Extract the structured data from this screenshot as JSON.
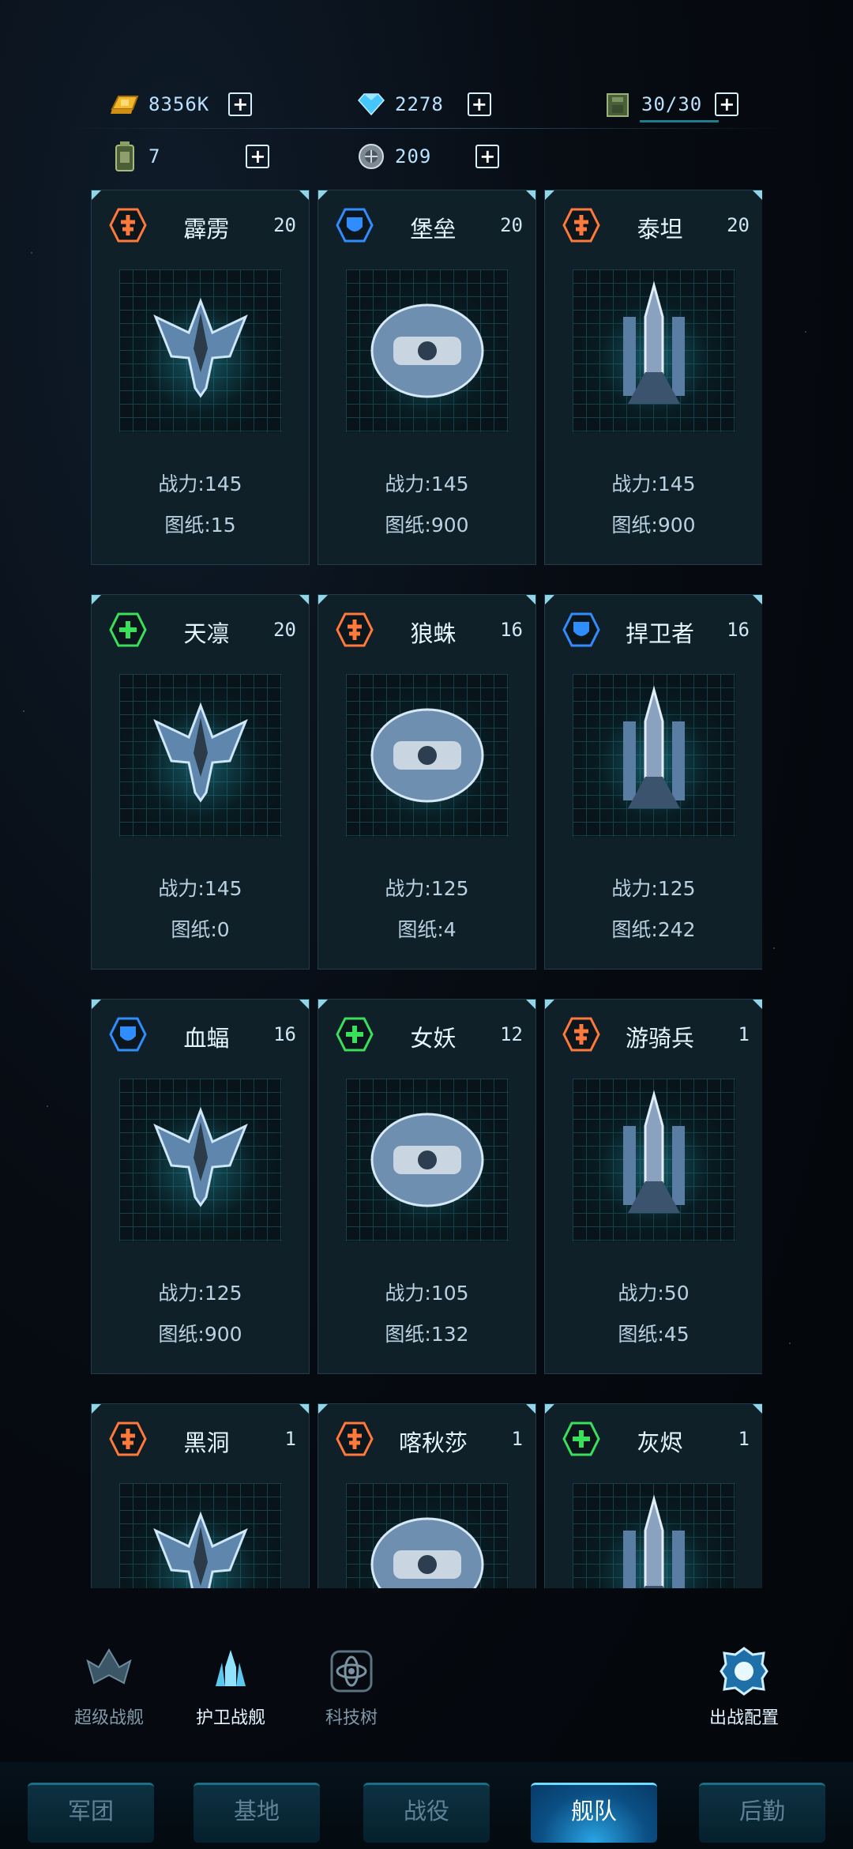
{
  "resources": {
    "gold": {
      "icon": "gold-bars-icon",
      "value": "8356K"
    },
    "diamond": {
      "icon": "diamond-icon",
      "value": "2278"
    },
    "capacity": {
      "icon": "cargo-crate-icon",
      "value": "30/30"
    },
    "fuel": {
      "icon": "fuel-canister-icon",
      "value": "7"
    },
    "alloy": {
      "icon": "alloy-disc-icon",
      "value": "209"
    }
  },
  "ships": [
    {
      "name": "霹雳",
      "level": "20",
      "type": "attack",
      "power": "战力:145",
      "blueprint": "图纸:15"
    },
    {
      "name": "堡垒",
      "level": "20",
      "type": "defense",
      "power": "战力:145",
      "blueprint": "图纸:900"
    },
    {
      "name": "泰坦",
      "level": "20",
      "type": "attack",
      "power": "战力:145",
      "blueprint": "图纸:900"
    },
    {
      "name": "天凛",
      "level": "20",
      "type": "support",
      "power": "战力:145",
      "blueprint": "图纸:0"
    },
    {
      "name": "狼蛛",
      "level": "16",
      "type": "attack",
      "power": "战力:125",
      "blueprint": "图纸:4"
    },
    {
      "name": "捍卫者",
      "level": "16",
      "type": "defense",
      "power": "战力:125",
      "blueprint": "图纸:242"
    },
    {
      "name": "血蝠",
      "level": "16",
      "type": "defense",
      "power": "战力:125",
      "blueprint": "图纸:900"
    },
    {
      "name": "女妖",
      "level": "12",
      "type": "support",
      "power": "战力:105",
      "blueprint": "图纸:132"
    },
    {
      "name": "游骑兵",
      "level": "1",
      "type": "attack",
      "power": "战力:50",
      "blueprint": "图纸:45"
    },
    {
      "name": "黑洞",
      "level": "1",
      "type": "attack",
      "power": "",
      "blueprint": ""
    },
    {
      "name": "喀秋莎",
      "level": "1",
      "type": "attack",
      "power": "",
      "blueprint": ""
    },
    {
      "name": "灰烬",
      "level": "1",
      "type": "support",
      "power": "",
      "blueprint": ""
    }
  ],
  "colors": {
    "attack": "#ff7a3a",
    "defense": "#2f8dff",
    "support": "#39e05a"
  },
  "subtabs": [
    {
      "label": "超级战舰",
      "icon": "super-warship-icon"
    },
    {
      "label": "护卫战舰",
      "icon": "escort-warship-icon",
      "active": true
    },
    {
      "label": "科技树",
      "icon": "tech-tree-icon"
    },
    {
      "label": "出战配置",
      "icon": "battle-config-icon"
    }
  ],
  "nav": [
    {
      "label": "军团"
    },
    {
      "label": "基地"
    },
    {
      "label": "战役"
    },
    {
      "label": "舰队",
      "active": true
    },
    {
      "label": "后勤"
    }
  ]
}
